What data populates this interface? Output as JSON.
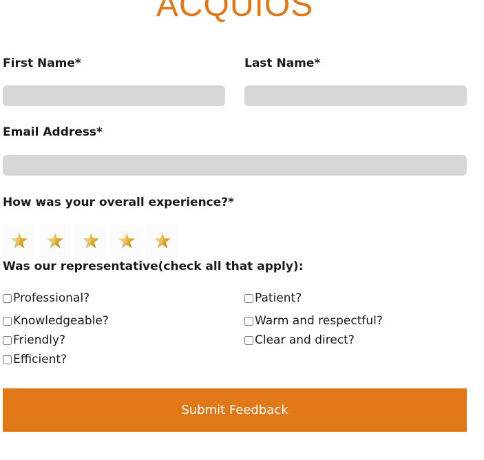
{
  "brand": {
    "name": "ACQUIOS",
    "color": "#e07818"
  },
  "form": {
    "first_name": {
      "label": "First Name*",
      "value": "",
      "placeholder": ""
    },
    "last_name": {
      "label": "Last Name*",
      "value": "",
      "placeholder": ""
    },
    "email": {
      "label": "Email Address*",
      "value": "",
      "placeholder": ""
    },
    "experience": {
      "question": "How was your overall experience?*",
      "max_rating": 5,
      "icon": "star-icon"
    },
    "representative": {
      "question": "Was our representative(check all that apply):",
      "options": [
        {
          "label": "Professional?",
          "checked": false
        },
        {
          "label": "Patient?",
          "checked": false
        },
        {
          "label": "Knowledgeable?",
          "checked": false
        },
        {
          "label": "Warm and respectful?",
          "checked": false
        },
        {
          "label": "Friendly?",
          "checked": false
        },
        {
          "label": "Clear and direct?",
          "checked": false
        },
        {
          "label": "Efficient?",
          "checked": false
        }
      ]
    },
    "submit_label": "Submit Feedback"
  },
  "colors": {
    "accent": "#e07818",
    "field_background": "#d6d8d8",
    "star_gold": "#e7c24a"
  }
}
